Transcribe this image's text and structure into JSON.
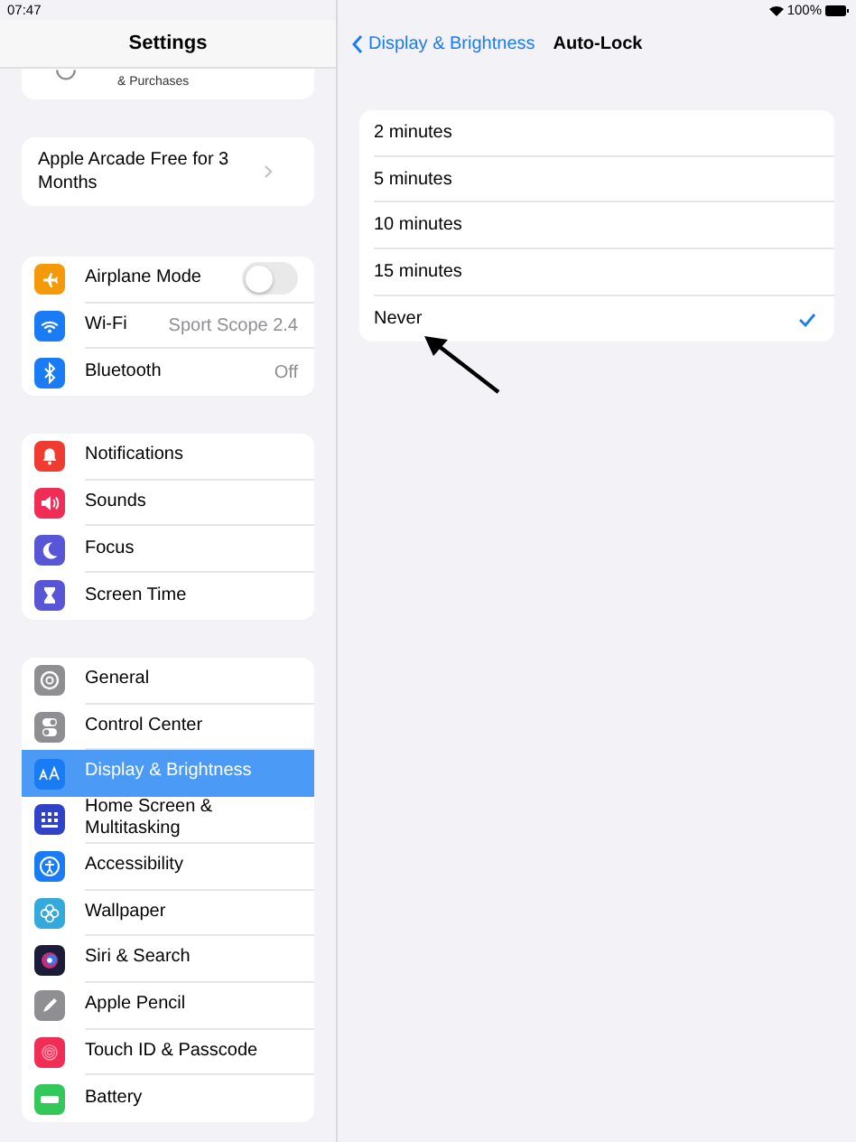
{
  "status_bar": {
    "time": "07:47",
    "battery": "100%"
  },
  "sidebar": {
    "title": "Settings",
    "profile": {
      "subtitle": "& Purchases"
    },
    "promo": {
      "text": "Apple Arcade Free for 3 Months"
    },
    "groups": [
      {
        "items": [
          {
            "label": "Airplane Mode",
            "kind": "toggle",
            "on": false,
            "selected": false
          },
          {
            "label": "Wi-Fi",
            "kind": "value",
            "value": "Sport Scope 2.4",
            "selected": false
          },
          {
            "label": "Bluetooth",
            "kind": "value",
            "value": "Off",
            "selected": false
          }
        ]
      },
      {
        "items": [
          {
            "label": "Notifications",
            "kind": "plain",
            "selected": false
          },
          {
            "label": "Sounds",
            "kind": "plain",
            "selected": false
          },
          {
            "label": "Focus",
            "kind": "plain",
            "selected": false
          },
          {
            "label": "Screen Time",
            "kind": "plain",
            "selected": false
          }
        ]
      },
      {
        "items": [
          {
            "label": "General",
            "kind": "plain",
            "selected": false
          },
          {
            "label": "Control Center",
            "kind": "plain",
            "selected": false
          },
          {
            "label": "Display & Brightness",
            "kind": "plain",
            "selected": true
          },
          {
            "label": "Home Screen & Multitasking",
            "kind": "plain",
            "selected": false
          },
          {
            "label": "Accessibility",
            "kind": "plain",
            "selected": false
          },
          {
            "label": "Wallpaper",
            "kind": "plain",
            "selected": false
          },
          {
            "label": "Siri & Search",
            "kind": "plain",
            "selected": false
          },
          {
            "label": "Apple Pencil",
            "kind": "plain",
            "selected": false
          },
          {
            "label": "Touch ID & Passcode",
            "kind": "plain",
            "selected": false
          },
          {
            "label": "Battery",
            "kind": "plain",
            "selected": false
          }
        ]
      }
    ]
  },
  "detail": {
    "back": "Display & Brightness",
    "title": "Auto-Lock",
    "options": [
      {
        "label": "2 minutes",
        "selected": false
      },
      {
        "label": "5 minutes",
        "selected": false
      },
      {
        "label": "10 minutes",
        "selected": false
      },
      {
        "label": "15 minutes",
        "selected": false
      },
      {
        "label": "Never",
        "selected": true
      }
    ]
  }
}
